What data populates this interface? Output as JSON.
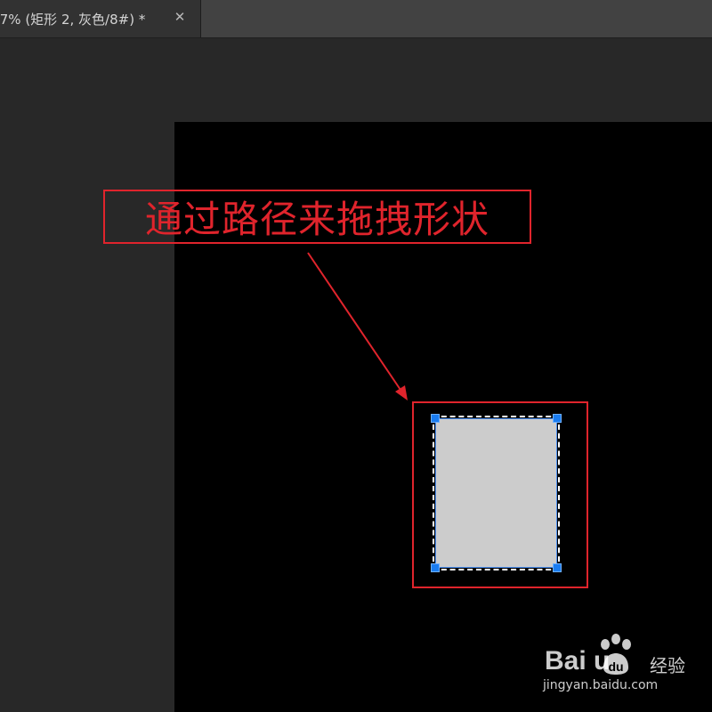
{
  "tab": {
    "title": ".7% (矩形 2, 灰色/8#) *",
    "close_label": "✕"
  },
  "callout": {
    "text": "通过路径来拖拽形状"
  },
  "colors": {
    "annotation_red": "#e0242c",
    "shape_fill": "#cccccc",
    "anchor_blue": "#1a7cf0",
    "canvas": "#000000",
    "workspace": "#282828"
  },
  "watermark": {
    "logo": "Bai  u",
    "brand": "经验",
    "url": "jingyan.baidu.com"
  }
}
